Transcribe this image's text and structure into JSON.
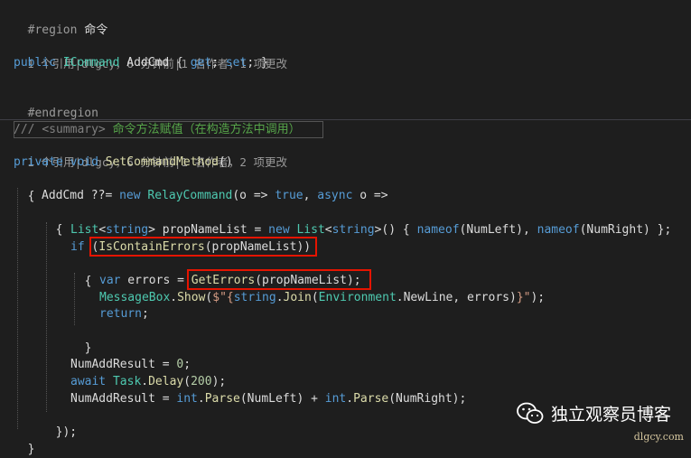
{
  "code": {
    "region_kw": "#region",
    "region_name": "命令",
    "lens1": "1 个引用|dlgcy，6 分钟前|1 名作者，1 项更改",
    "prop": {
      "public": "public",
      "type": "ICommand",
      "name": "AddCmd",
      "open": "{",
      "get": "get",
      "semi1": ";",
      "set": "set",
      "close": "; }"
    },
    "endregion": "#endregion",
    "summary_slashes": "///",
    "summary_tag": "<summary>",
    "summary_text": "命令方法赋值（在构造方法中调用）",
    "lens2": "1 个引用|dlgcy，6 分钟前|1 名作者，2 项更改",
    "method": {
      "private": "private",
      "void": "void",
      "name": "SetCommandMethod",
      "parens": "()"
    },
    "open_brace": "{",
    "close_brace": "}",
    "l_addcmd": {
      "name": "AddCmd",
      "op": " ??= ",
      "new": "new",
      "type": "RelayCommand",
      "p1": "(o => ",
      "true": "true",
      "comma": ", ",
      "async": "async",
      "p2": " o =>"
    },
    "l_list": {
      "list1": "List",
      "lt1": "<",
      "string1": "string",
      "gt1": "> propNameList = ",
      "new": "new",
      "list2": "List",
      "lt2": "<",
      "string2": "string",
      "gt2": ">() { ",
      "nameof1": "nameof",
      "arg1": "(NumLeft), ",
      "nameof2": "nameof",
      "arg2": "(NumRight) };"
    },
    "l_if": {
      "if": "if",
      "p1": " (",
      "fn": "IsContainErrors",
      "p2": "(propNameList))"
    },
    "l_var": {
      "var": "var",
      "p1": " errors = ",
      "fn": "GetErrors",
      "p2": "(propNameList);"
    },
    "l_msg": {
      "type": "MessageBox",
      "dot1": ".",
      "fn": "Show",
      "p1": "(",
      "str1": "$\"{",
      "string": "string",
      "dot2": ".",
      "join": "Join",
      "p2": "(",
      "env": "Environment",
      "p3": ".NewLine, errors)",
      "str2": "}\"",
      "p4": ");"
    },
    "return_kw": "return",
    "return_semi": ";",
    "l_num1": {
      "name": "NumAddResult = ",
      "num": "0",
      "semi": ";"
    },
    "l_await": {
      "await": "await",
      "sp": " ",
      "task": "Task",
      "dot": ".",
      "fn": "Delay",
      "p1": "(",
      "num": "200",
      "p2": ");"
    },
    "l_num2": {
      "name": "NumAddResult = ",
      "int1": "int",
      "dot1": ".",
      "parse1": "Parse",
      "arg1": "(NumLeft) + ",
      "int2": "int",
      "dot2": ".",
      "parse2": "Parse",
      "arg2": "(NumRight);"
    },
    "close_lambda": "});"
  },
  "watermark": {
    "name": "独立观察员博客",
    "url": "dlgcy.com"
  },
  "colors": {
    "background": "#1e1e1e",
    "keyword": "#569cd6",
    "type": "#4ec9b0",
    "method": "#dcdcaa",
    "highlight_box": "#e51400"
  }
}
